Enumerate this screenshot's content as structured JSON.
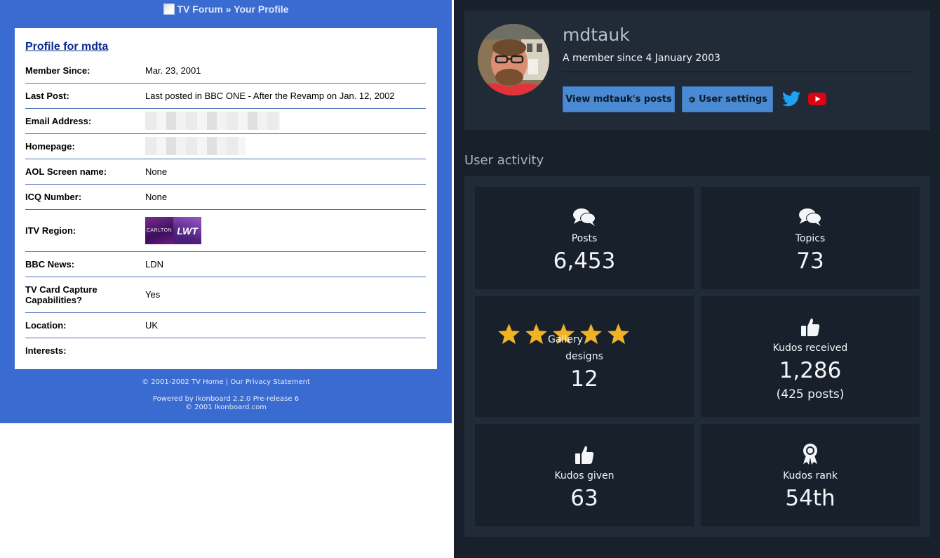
{
  "old_forum": {
    "breadcrumb": "TV Forum » Your Profile",
    "profile_title": "Profile for mdta",
    "fields": [
      {
        "label": "Member Since:",
        "value": "Mar. 23, 2001"
      },
      {
        "label": "Last Post:",
        "value": "Last posted in BBC ONE - After the Revamp on Jan. 12, 2002"
      },
      {
        "label": "Email Address:",
        "value": ""
      },
      {
        "label": "Homepage:",
        "value": ""
      },
      {
        "label": "AOL Screen name:",
        "value": "None"
      },
      {
        "label": "ICQ Number:",
        "value": "None"
      },
      {
        "label": "ITV Region:",
        "value": ""
      },
      {
        "label": "BBC News:",
        "value": "LDN"
      },
      {
        "label": "TV Card Capture Capabilities?",
        "value": "Yes"
      },
      {
        "label": "Location:",
        "value": "UK"
      },
      {
        "label": "Interests:",
        "value": ""
      }
    ],
    "itv_logos": {
      "left": "CARLTON",
      "right": "LWT"
    },
    "footer_line1": "© 2001-2002 TV Home | Our Privacy Statement",
    "footer_line2": "Powered by Ikonboard 2.2.0 Pre-release 6",
    "footer_line3": "© 2001 Ikonboard.com",
    "colors": {
      "background": "#3a6bd1",
      "separator": "#4a6fb9",
      "title": "#0a2a8f"
    }
  },
  "new_forum": {
    "username": "mdtauk",
    "member_since": "A member since 4 January 2003",
    "buttons": {
      "view_posts": "View mdtauk's posts",
      "settings": "User settings"
    },
    "social_icons": [
      "twitter-icon",
      "youtube-icon"
    ],
    "section_title": "User activity",
    "stats": {
      "posts": {
        "label": "Posts",
        "value": "6,453"
      },
      "topics": {
        "label": "Topics",
        "value": "73"
      },
      "gallery": {
        "label": "Gallery designs",
        "value": "12",
        "stars": 5
      },
      "kudos_received": {
        "label": "Kudos received",
        "value": "1,286",
        "sub": "(425 posts)"
      },
      "kudos_given": {
        "label": "Kudos given",
        "value": "63"
      },
      "kudos_rank": {
        "label": "Kudos rank",
        "value": "54th"
      }
    },
    "colors": {
      "background": "#18202b",
      "card": "#212b38",
      "button": "#4a8ad2",
      "link": "#7ea4c9",
      "star": "#f1b224",
      "twitter": "#1da1f2",
      "youtube": "#e00012"
    }
  }
}
